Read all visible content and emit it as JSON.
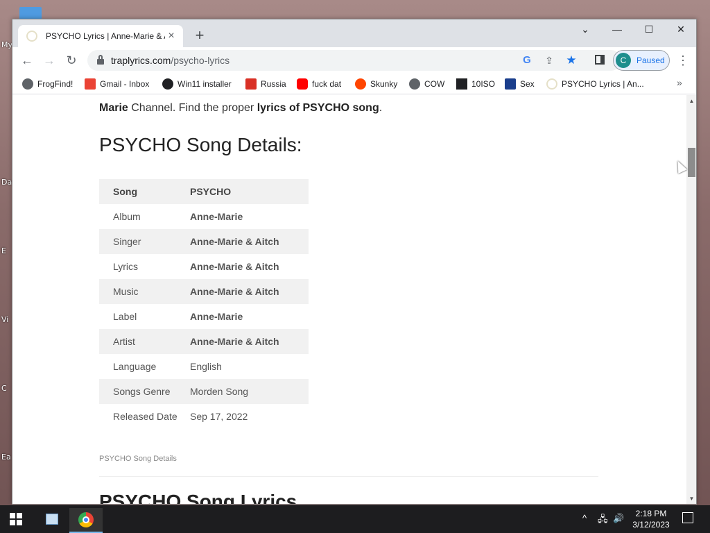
{
  "desktop": {
    "labels": [
      "My",
      "Da",
      "E",
      "Vi",
      "C",
      "Ea"
    ]
  },
  "browser": {
    "tab_title": "PSYCHO Lyrics | Anne-Marie & A",
    "tab_close": "×",
    "new_tab": "+",
    "window_controls": {
      "dropdown": "⌄",
      "minimize": "—",
      "maximize": "☐",
      "close": "✕"
    },
    "nav": {
      "back": "←",
      "forward": "→",
      "reload": "↻"
    },
    "url_host": "traplyrics.com",
    "url_path": "/psycho-lyrics",
    "google_icon": "G",
    "share_icon": "⇪",
    "star_icon": "★",
    "profile_initial": "C",
    "profile_status": "Paused",
    "menu": "⋮",
    "bookmarks": [
      {
        "label": "FrogFind!",
        "icon": "globe-icon",
        "color": "#5f6368"
      },
      {
        "label": "Gmail - Inbox",
        "icon": "gmail-icon",
        "color": "#ea4335"
      },
      {
        "label": "Win11 installer",
        "icon": "github-icon",
        "color": "#202124"
      },
      {
        "label": "Russia",
        "icon": "russia-icon",
        "color": "#d93025"
      },
      {
        "label": "fuck dat",
        "icon": "youtube-icon",
        "color": "#ff0000"
      },
      {
        "label": "Skunky",
        "icon": "reddit-icon",
        "color": "#ff4500"
      },
      {
        "label": "COW",
        "icon": "globe-icon",
        "color": "#5f6368"
      },
      {
        "label": "10ISO",
        "icon": "building-icon",
        "color": "#202124"
      },
      {
        "label": "Sex",
        "icon": "s-icon",
        "color": "#1a3e8c"
      },
      {
        "label": "PSYCHO Lyrics | An...",
        "icon": "loading-icon",
        "color": "#e5e0c8"
      }
    ],
    "bookmarks_more": "»"
  },
  "page": {
    "intro_bold_1": "Marie",
    "intro_text_1": " Channel. Find the proper ",
    "intro_bold_2": "lyrics of PSYCHO song",
    "intro_text_2": ".",
    "heading": "PSYCHO Song Details:",
    "table": [
      {
        "key": "Song",
        "value": "PSYCHO"
      },
      {
        "key": "Album",
        "value": "Anne-Marie"
      },
      {
        "key": "Singer",
        "value": "Anne-Marie & Aitch"
      },
      {
        "key": "Lyrics",
        "value": "Anne-Marie & Aitch"
      },
      {
        "key": "Music",
        "value": "Anne-Marie & Aitch"
      },
      {
        "key": "Label",
        "value": "Anne-Marie"
      },
      {
        "key": "Artist",
        "value": "Anne-Marie & Aitch"
      },
      {
        "key": "Language",
        "value": "English"
      },
      {
        "key": "Songs Genre",
        "value": "Morden Song"
      },
      {
        "key": "Released Date",
        "value": "Sep 17, 2022"
      }
    ],
    "caption": "PSYCHO Song Details",
    "next_heading": "PSYCHO Song Lyrics"
  },
  "scrollbar": {
    "up": "▲",
    "down": "▼"
  },
  "taskbar": {
    "tray_chevron": "^",
    "tray_network": "🖧",
    "tray_volume": "🔊",
    "time": "2:18 PM",
    "date": "3/12/2023"
  }
}
